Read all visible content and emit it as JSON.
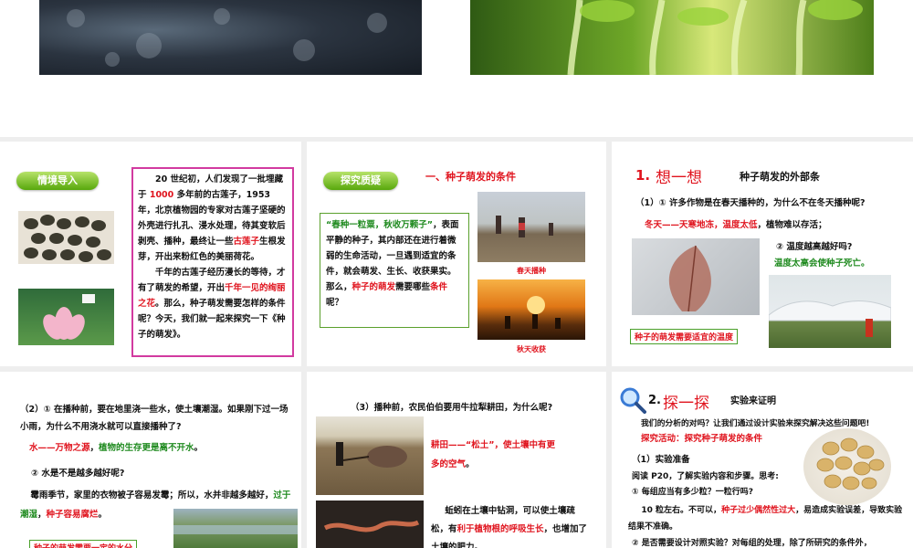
{
  "top": {},
  "s1": {
    "badge": "情境导入",
    "p1_a": "20 世纪初，人们发现了一批埋藏于",
    "p1_num": "1000",
    "p1_b": "多年前的古莲子，1953 年，北京植物园的专家对古莲子坚硬的外壳进行扎孔、浸水处理，待其变软后剥壳、播种，最终让一些",
    "p1_red": "古莲子",
    "p1_c": "生根发芽，开出来粉红色的美丽荷花。",
    "p2_a": "千年的古莲子经历漫长的等待，才有了萌发的希望，开出",
    "p2_red": "千年一见的绚丽之花",
    "p2_b": "。那么，种子萌发需要怎样的条件呢？今天，我们就一起来探究一下《种子的萌发》。"
  },
  "s2": {
    "badge": "探究质疑",
    "title": "一、种子萌发的条件",
    "quote_green": "“春种一粒粟，秋收万颗子”",
    "quote_b": "，表面平静的种子，其内部还在进行着微弱的生命活动，一旦遇到适宜的条件，就会萌发、生长、收获果实。那么，",
    "quote_red": "种子的萌发",
    "quote_c": "需要哪些",
    "quote_red2": "条件",
    "quote_d": "呢？",
    "cap1": "春天播种",
    "cap2": "秋天收获"
  },
  "s3": {
    "num": "1.",
    "head": "想一想",
    "sub": "种子萌发的外部条",
    "q1": "（1）① 许多作物是在春天播种的，为什么不在冬天播种呢?",
    "a1_red": "冬天——天寒地冻，温度太低",
    "a1_b": "，植物难以存活；",
    "q2": "② 温度越高越好吗?",
    "a2_green": "温度太高会使种子死亡。",
    "conclusion": "种子的萌发需要适宜的温度"
  },
  "s4": {
    "q1": "（2）① 在播种前，要在地里浇一些水，使土壤潮湿。如果刚下过一场小雨，为什么不用浇水就可以直接播种了?",
    "a1_red": "水——万物之源",
    "a1_b": "，",
    "a1_green": "植物的生存更是离不开水",
    "a1_c": "。",
    "q2": "② 水是不是越多越好呢?",
    "a2_a": "霉雨季节，家里的衣物被子容易发霉；所以，水并非越多越好，",
    "a2_green": "过于潮湿",
    "a2_b": "，",
    "a2_red": "种子容易腐烂",
    "a2_c": "。",
    "conclusion": "种子的萌发需要一定的水分"
  },
  "s5": {
    "q": "（3）播种前，农民伯伯要用牛拉犁耕田，为什么呢?",
    "a1_red": "耕田——“松土”，使土壤中有更多的空气",
    "a1_b": "。",
    "a2_a": "蚯蚓在土壤中钻洞，可以使土壤疏松，有",
    "a2_red": "利于植物根的呼吸生长",
    "a2_b": "，也增加了土壤的肥力。"
  },
  "s6": {
    "num": "2.",
    "head": "探一探",
    "sub": "实验来证明",
    "intro": "我们的分析的对吗？让我们通过设计实验来探究解决这些问题吧!",
    "activity": "探究活动：探究种子萌发的条件",
    "prep": "（1）实验准备",
    "read": "阅读 P20，了解实验内容和步骤。思考:",
    "q1": "① 每组应当有多少粒？一粒行吗?",
    "a1_a": "10 粒左右。不可以，",
    "a1_red": "种子过少偶然性过大",
    "a1_b": "，易造成实验误差，导致实验结果不准确。",
    "q2": "② 是否需要设计对照实验？对每组的处理，除了所研究的条件外，"
  }
}
